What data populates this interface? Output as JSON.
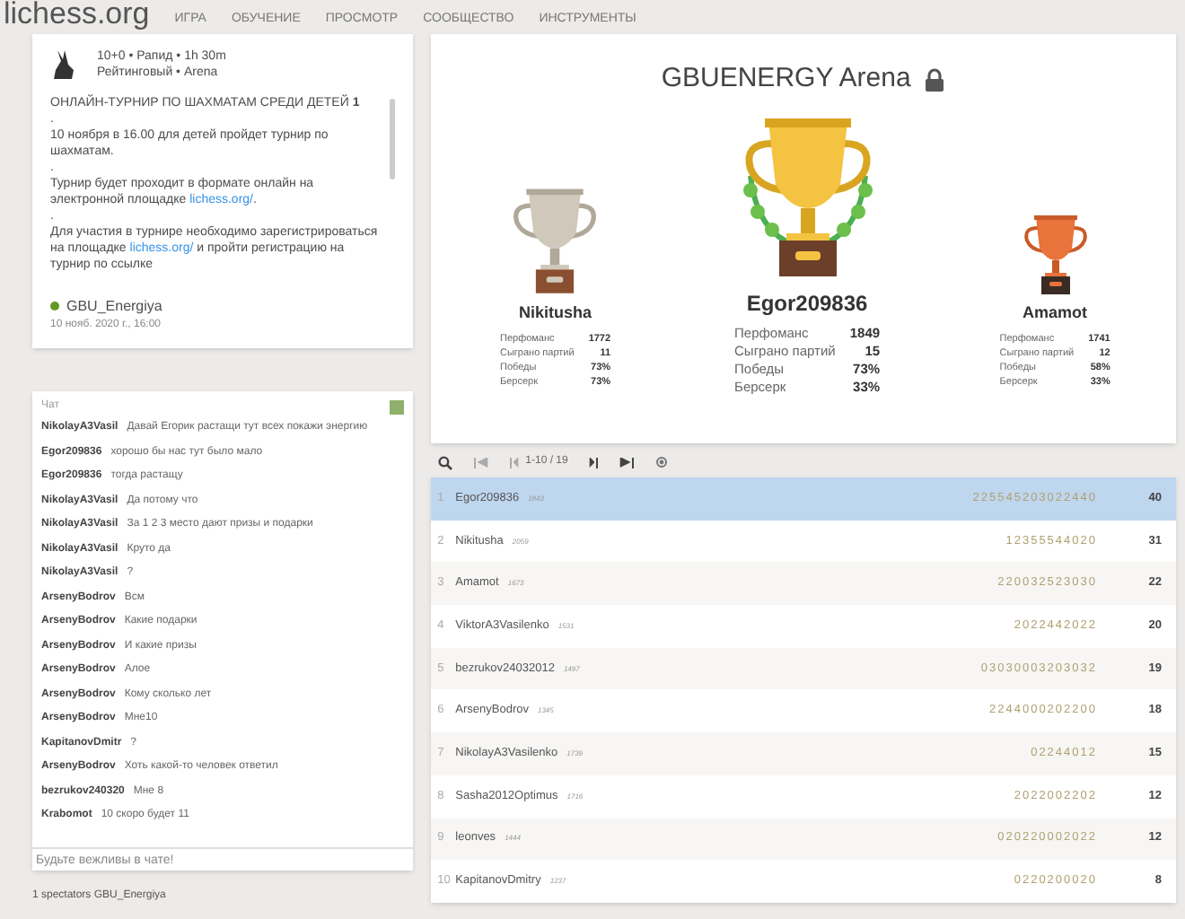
{
  "header": {
    "logo": "lichess.org",
    "nav": [
      "ИГРА",
      "ОБУЧЕНИЕ",
      "ПРОСМОТР",
      "СООБЩЕСТВО",
      "ИНСТРУМЕНТЫ"
    ]
  },
  "info": {
    "setup": "10+0 • Рапид • 1h 30m",
    "mode": "Рейтинговый • Arena",
    "description": [
      [
        {
          "kind": "text",
          "text": "ОНЛАЙН-ТУРНИР ПО ШАХМАТАМ СРЕДИ ДЕТЕЙ **1**"
        }
      ],
      [
        {
          "kind": "text",
          "text": "."
        }
      ],
      [
        {
          "kind": "text",
          "text": "10 ноября в 16.00 для детей пройдет турнир по шахматам."
        }
      ],
      [
        {
          "kind": "text",
          "text": "."
        }
      ],
      [
        {
          "kind": "text",
          "text": "Турнир будет проходит в формате онлайн на электронной площадке "
        },
        {
          "kind": "link",
          "text": "lichess.org/"
        },
        {
          "kind": "text",
          "text": "."
        }
      ],
      [
        {
          "kind": "text",
          "text": "."
        }
      ],
      [
        {
          "kind": "text",
          "text": "Для участия в турнире необходимо зарегистрироваться на площадке "
        },
        {
          "kind": "link",
          "text": "lichess.org/"
        },
        {
          "kind": "text",
          "text": " и пройти регистрацию на турнир по ссылке"
        }
      ]
    ],
    "author": "GBU_Energiya",
    "date": "10 нояб. 2020 г., 16:00"
  },
  "chat": {
    "title": "Чат",
    "messages": [
      {
        "user": "NikolayA3Vasil",
        "text": "Давай Егорик растащи тут всех покажи энергию"
      },
      {
        "user": "Egor209836",
        "text": "хорошо бы нас тут было мало"
      },
      {
        "user": "Egor209836",
        "text": "тогда растащу"
      },
      {
        "user": "NikolayA3Vasil",
        "text": "Да потому что"
      },
      {
        "user": "NikolayA3Vasil",
        "text": "За 1 2 3 место дают призы и подарки"
      },
      {
        "user": "NikolayA3Vasil",
        "text": "Круто да"
      },
      {
        "user": "NikolayA3Vasil",
        "text": "?"
      },
      {
        "user": "ArsenyBodrov",
        "text": "Всм"
      },
      {
        "user": "ArsenyBodrov",
        "text": "Какие подарки"
      },
      {
        "user": "ArsenyBodrov",
        "text": "И какие призы"
      },
      {
        "user": "ArsenyBodrov",
        "text": "Алое"
      },
      {
        "user": "ArsenyBodrov",
        "text": "Кому сколько лет"
      },
      {
        "user": "ArsenyBodrov",
        "text": "Мне10"
      },
      {
        "user": "KapitanovDmitr",
        "text": "?"
      },
      {
        "user": "ArsenyBodrov",
        "text": "Хоть какой-то человек ответил"
      },
      {
        "user": "bezrukov240320",
        "text": "Мне 8"
      },
      {
        "user": "Krabomot",
        "text": "10 скоро будет 11"
      }
    ],
    "placeholder": "Будьте вежливы в чате!"
  },
  "spectators": "1 spectators GBU_Energiya",
  "tournament": {
    "title": "GBUENERGY Arena",
    "podium": [
      {
        "kind": "silver",
        "name": "Nikitusha",
        "stats": [
          [
            "Перфоманс",
            "1772"
          ],
          [
            "Сыграно партий",
            "11"
          ],
          [
            "Победы",
            "73%"
          ],
          [
            "Берсерк",
            "73%"
          ]
        ]
      },
      {
        "kind": "gold",
        "name": "Egor209836",
        "stats": [
          [
            "Перфоманс",
            "1849"
          ],
          [
            "Сыграно партий",
            "15"
          ],
          [
            "Победы",
            "73%"
          ],
          [
            "Берсерк",
            "33%"
          ]
        ]
      },
      {
        "kind": "bronze",
        "name": "Amamot",
        "stats": [
          [
            "Перфоманс",
            "1741"
          ],
          [
            "Сыграно партий",
            "12"
          ],
          [
            "Победы",
            "58%"
          ],
          [
            "Берсерк",
            "33%"
          ]
        ]
      }
    ]
  },
  "pager": {
    "range": "1-10 / 19"
  },
  "standings": [
    {
      "rank": "1",
      "name": "Egor209836",
      "rating": "1843",
      "sheet": "225545203022440",
      "score": "40",
      "selected": true
    },
    {
      "rank": "2",
      "name": "Nikitusha",
      "rating": "2059",
      "sheet": "12355544020",
      "score": "31",
      "selected": false
    },
    {
      "rank": "3",
      "name": "Amamot",
      "rating": "1673",
      "sheet": "220032523030",
      "score": "22",
      "selected": false
    },
    {
      "rank": "4",
      "name": "ViktorA3Vasilenko",
      "rating": "1531",
      "sheet": "2022442022",
      "score": "20",
      "selected": false
    },
    {
      "rank": "5",
      "name": "bezrukov24032012",
      "rating": "1497",
      "sheet": "03030003203032",
      "score": "19",
      "selected": false
    },
    {
      "rank": "6",
      "name": "ArsenyBodrov",
      "rating": "1345",
      "sheet": "2244000202200",
      "score": "18",
      "selected": false
    },
    {
      "rank": "7",
      "name": "NikolayA3Vasilenko",
      "rating": "1739",
      "sheet": "02244012",
      "score": "15",
      "selected": false
    },
    {
      "rank": "8",
      "name": "Sasha2012Optimus",
      "rating": "1716",
      "sheet": "2022002202",
      "score": "12",
      "selected": false
    },
    {
      "rank": "9",
      "name": "leonves",
      "rating": "1444",
      "sheet": "020220002022",
      "score": "12",
      "selected": false
    },
    {
      "rank": "10",
      "name": "KapitanovDmitry",
      "rating": "1237",
      "sheet": "0220200020",
      "score": "8",
      "selected": false
    }
  ]
}
